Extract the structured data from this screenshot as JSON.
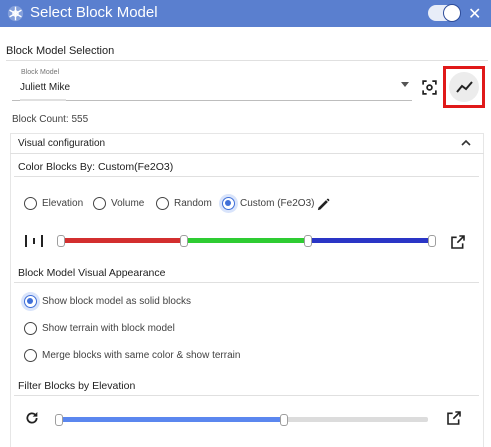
{
  "window": {
    "title": "Select Block Model",
    "app_icon": "gear-snowflake-icon",
    "toggle_on": true,
    "close_icon": "close-icon"
  },
  "selection": {
    "heading": "Block Model Selection",
    "field_label": "Block Model",
    "field_value": "Juliett Mike",
    "scan_icon": "focus-scan-icon",
    "stats_icon": "trend-line-icon",
    "block_count": "Block Count: 555"
  },
  "visual": {
    "panel_title": "Visual configuration",
    "collapse_icon": "chevron-up-icon",
    "color_heading": "Color Blocks By: Custom(Fe2O3)",
    "color_options": [
      {
        "label": "Elevation",
        "checked": false
      },
      {
        "label": "Volume",
        "checked": false
      },
      {
        "label": "Random",
        "checked": false
      },
      {
        "label": "Custom (Fe2O3)",
        "checked": true
      }
    ],
    "edit_icon": "pencil-icon",
    "split_icon": "column-split-icon",
    "open_icon": "open-external-icon",
    "color_segments": [
      "#d32f2f",
      "#2ecc32",
      "#2a35c6"
    ],
    "appearance_heading": "Block Model Visual Appearance",
    "appearance_options": [
      {
        "label": "Show block model as solid blocks",
        "checked": true
      },
      {
        "label": "Show terrain with block model",
        "checked": false
      },
      {
        "label": "Merge blocks with same color & show terrain",
        "checked": false
      }
    ],
    "filter_heading": "Filter Blocks by Elevation",
    "refresh_icon": "refresh-icon",
    "elevation_filter_fraction": 0.61,
    "accent": "#3f6fd8",
    "filter_track_color": "#5b87ef"
  }
}
